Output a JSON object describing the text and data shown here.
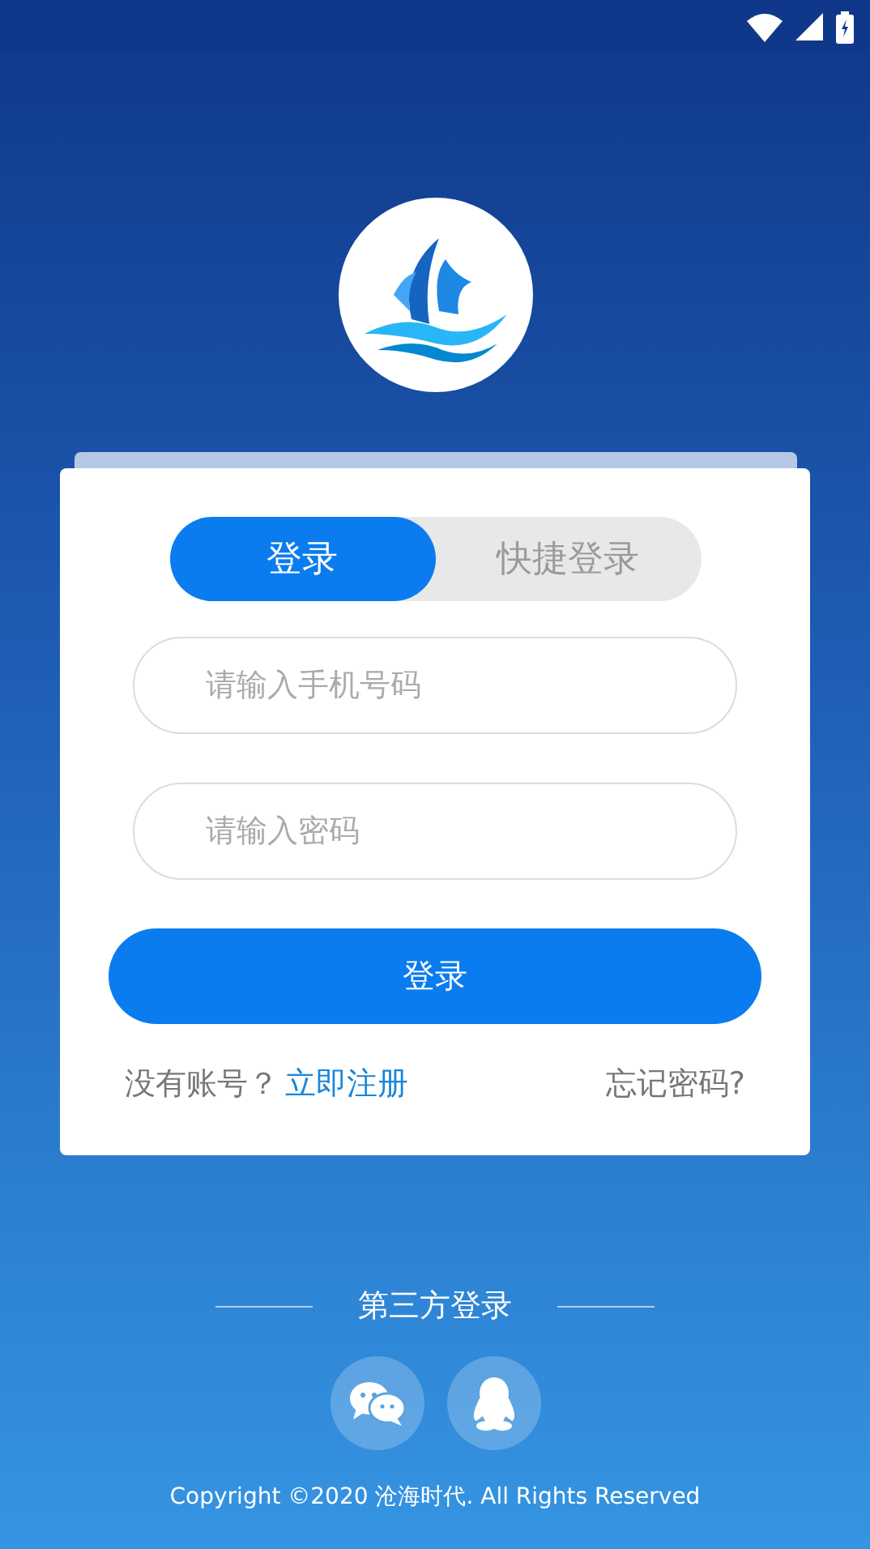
{
  "tabs": [
    {
      "label": "登录",
      "selected": true
    },
    {
      "label": "快捷登录",
      "selected": false
    }
  ],
  "fields": [
    {
      "placeholder": "请输入手机号码"
    },
    {
      "placeholder": "请输入密码"
    }
  ],
  "login_button": "登录",
  "register_prompt": "没有账号？",
  "register_link": "立即注册",
  "forgot_link": "忘记密码?",
  "third_party": {
    "title": "第三方登录",
    "providers": [
      {
        "kind": "wechat"
      },
      {
        "kind": "qq"
      }
    ]
  },
  "copyright": "Copyright ©2020 沧海时代. All Rights Reserved"
}
